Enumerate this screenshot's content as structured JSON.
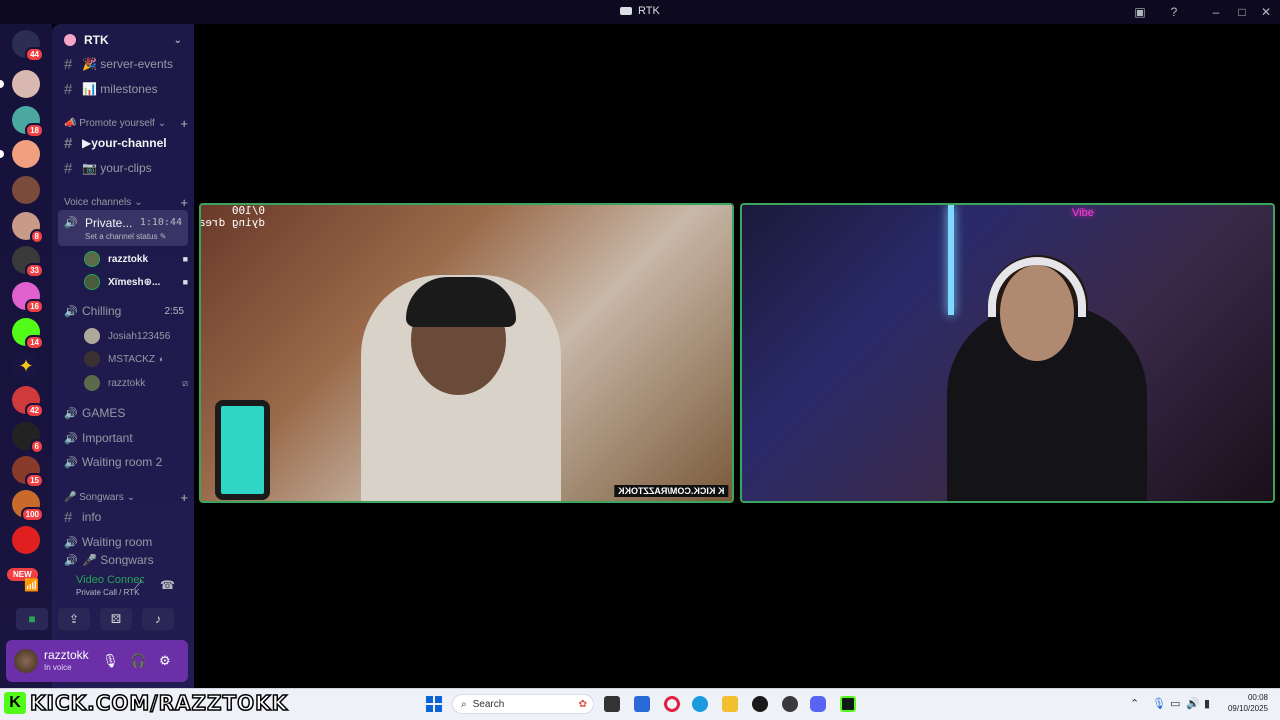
{
  "window": {
    "title": "RTK"
  },
  "server": {
    "name": "RTK"
  },
  "servers": [
    {
      "badge": "44"
    },
    {
      "badge": ""
    },
    {
      "badge": "18"
    },
    {
      "badge": ""
    },
    {
      "badge": ""
    },
    {
      "badge": "8"
    },
    {
      "badge": "33"
    },
    {
      "badge": "16"
    },
    {
      "badge": "14"
    },
    {
      "badge": ""
    },
    {
      "badge": "42"
    },
    {
      "badge": "6"
    },
    {
      "badge": "15"
    },
    {
      "badge": "100"
    },
    {
      "badge": ""
    }
  ],
  "new_pill": "NEW",
  "channels": {
    "server_events": "🎉 server-events",
    "milestones": "📊 milestones",
    "promote_category": "📣 Promote yourself",
    "your_channel": "▶your-channel",
    "your_clips": "📷 your-clips",
    "voice_category": "Voice channels",
    "private_name": "Private...",
    "private_time": "1:10:44",
    "private_status": "Set a channel status ✎",
    "private_members": [
      {
        "name": "razztokk"
      },
      {
        "name": "Xïmesh⊕..."
      }
    ],
    "chilling": "Chilling",
    "chilling_time": "2:55",
    "chilling_members": [
      {
        "name": "Josiah123456"
      },
      {
        "name": "MSTACKZ"
      },
      {
        "name": "razztokk"
      }
    ],
    "games": "GAMES",
    "important": "Important",
    "waiting2": "Waiting room 2",
    "songwars_category": "🎤 Songwars",
    "info": "info",
    "waiting": "Waiting room",
    "songwars_partial": "🎤 Songwars"
  },
  "voice_panel": {
    "title": "Video Connected",
    "subtitle": "Private Call / RTK"
  },
  "user": {
    "name": "razztokk",
    "status": "In voice"
  },
  "tile1": {
    "overlay_line1": "0/100",
    "overlay_line2": "dying dreads",
    "watermark": "K KICK.COM/RAZZTOKK"
  },
  "tile2": {
    "neon_sign": "Vibe"
  },
  "stream_banner": {
    "letter": "K",
    "text": "KICK.COM/RAZZTOKK"
  },
  "taskbar": {
    "search_placeholder": "Search",
    "time": "00:08",
    "date": "09/10/2025"
  },
  "colors": {
    "accent": "#5865f2",
    "voice_green": "#23a55a",
    "speaking_border": "#3ba55d",
    "kick_green": "#53fc18",
    "userbar": "#6b2fa8"
  }
}
